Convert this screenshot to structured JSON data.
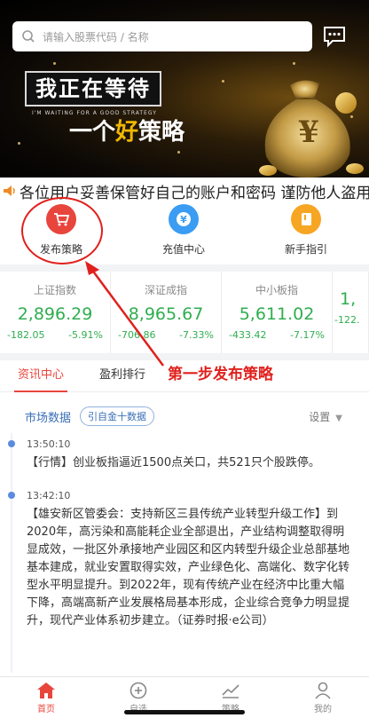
{
  "search": {
    "placeholder": "请输入股票代码 / 名称"
  },
  "banner": {
    "headline1": "我正在等待",
    "subtitle": "I'M WAITING FOR A GOOD STRATEGY",
    "headline2_prefix": "一个",
    "headline2_gold": "好",
    "headline2_suffix": "策略"
  },
  "marquee": {
    "text": "各位用户妥善保管好自己的账户和密码 谨防他人盗用"
  },
  "quick_menu": [
    {
      "label": "发布策略",
      "icon": "cart-icon",
      "color": "#e8453c"
    },
    {
      "label": "充值中心",
      "icon": "yen-icon",
      "color": "#3a9cf2"
    },
    {
      "label": "新手指引",
      "icon": "book-icon",
      "color": "#f7a623"
    }
  ],
  "indices": [
    {
      "name": "上证指数",
      "value": "2,896.29",
      "change": "-182.05",
      "pct": "-5.91%"
    },
    {
      "name": "深证成指",
      "value": "8,965.67",
      "change": "-706.86",
      "pct": "-7.33%"
    },
    {
      "name": "中小板指",
      "value": "5,611.02",
      "change": "-433.42",
      "pct": "-7.17%"
    },
    {
      "name": "",
      "value": "1,",
      "change": "-122.",
      "pct": ""
    }
  ],
  "tabs": [
    {
      "label": "资讯中心",
      "active": true
    },
    {
      "label": "盈利排行",
      "active": false
    }
  ],
  "annotation": {
    "text": "第一步发布策略"
  },
  "news": {
    "title": "市场数据",
    "tag": "引自金十数据",
    "settings": "设置",
    "items": [
      {
        "time": "13:50:10",
        "text": "【行情】创业板指逼近1500点关口，共521只个股跌停。"
      },
      {
        "time": "13:42:10",
        "text": "【雄安新区管委会：支持新区三县传统产业转型升级工作】到2020年，高污染和高能耗企业全部退出，产业结构调整取得明显成效，一批区外承接地产业园区和区内转型升级企业总部基地基本建成，就业安置取得实效，产业绿色化、高端化、数字化转型水平明显提升。到2022年，现有传统产业在经济中比重大幅下降，高端高新产业发展格局基本形成，企业综合竞争力明显提升，现代产业体系初步建立。（证券时报·e公司）"
      }
    ]
  },
  "bottom_nav": [
    {
      "label": "首页",
      "icon": "home-icon",
      "active": true
    },
    {
      "label": "自选",
      "icon": "plus-circle-icon",
      "active": false
    },
    {
      "label": "策略",
      "icon": "trend-icon",
      "active": false
    },
    {
      "label": "我的",
      "icon": "user-icon",
      "active": false
    }
  ],
  "colors": {
    "accent": "#e8453c",
    "up_green": "#2fae4f",
    "link_blue": "#3a6fb7"
  }
}
